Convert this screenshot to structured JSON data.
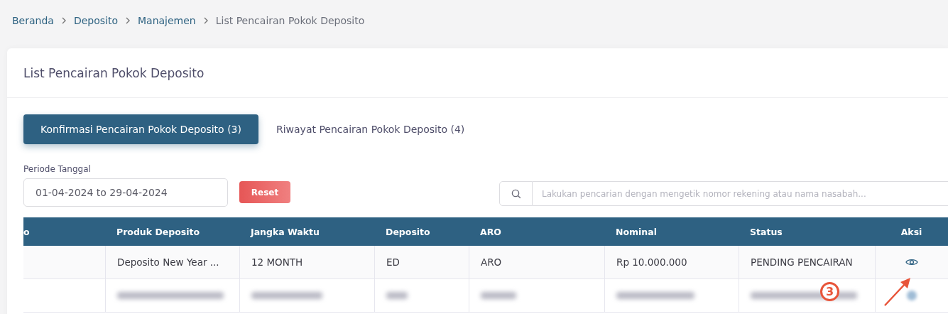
{
  "breadcrumb": [
    {
      "label": "Beranda",
      "kind": "link"
    },
    {
      "label": "Deposito",
      "kind": "link"
    },
    {
      "label": "Manajemen",
      "kind": "link"
    },
    {
      "label": "List Pencairan Pokok Deposito",
      "kind": "current"
    }
  ],
  "card": {
    "title": "List Pencairan Pokok Deposito"
  },
  "tabs": [
    {
      "label": "Konfirmasi Pencairan Pokok Deposito (3)",
      "selected": true
    },
    {
      "label": "Riwayat Pencairan Pokok Deposito (4)",
      "selected": false
    }
  ],
  "date_filter": {
    "label": "Periode Tanggal",
    "value": "01-04-2024 to 29-04-2024"
  },
  "reset_button": "Reset",
  "search": {
    "placeholder": "Lakukan pencarian dengan mengetik nomor rekening atau nama nasabah..."
  },
  "table": {
    "columns": [
      "o",
      "Produk Deposito",
      "Jangka Waktu",
      "Deposito",
      "ARO",
      "Nominal",
      "Status",
      "Aksi"
    ],
    "rows": [
      {
        "kind": "data",
        "cells": [
          "",
          "Deposito New Year ...",
          "12 MONTH",
          "ED",
          "ARO",
          "Rp 10.000.000",
          "PENDING PENCAIRAN"
        ]
      },
      {
        "kind": "blurred"
      }
    ]
  },
  "annotation": {
    "label": "3"
  }
}
